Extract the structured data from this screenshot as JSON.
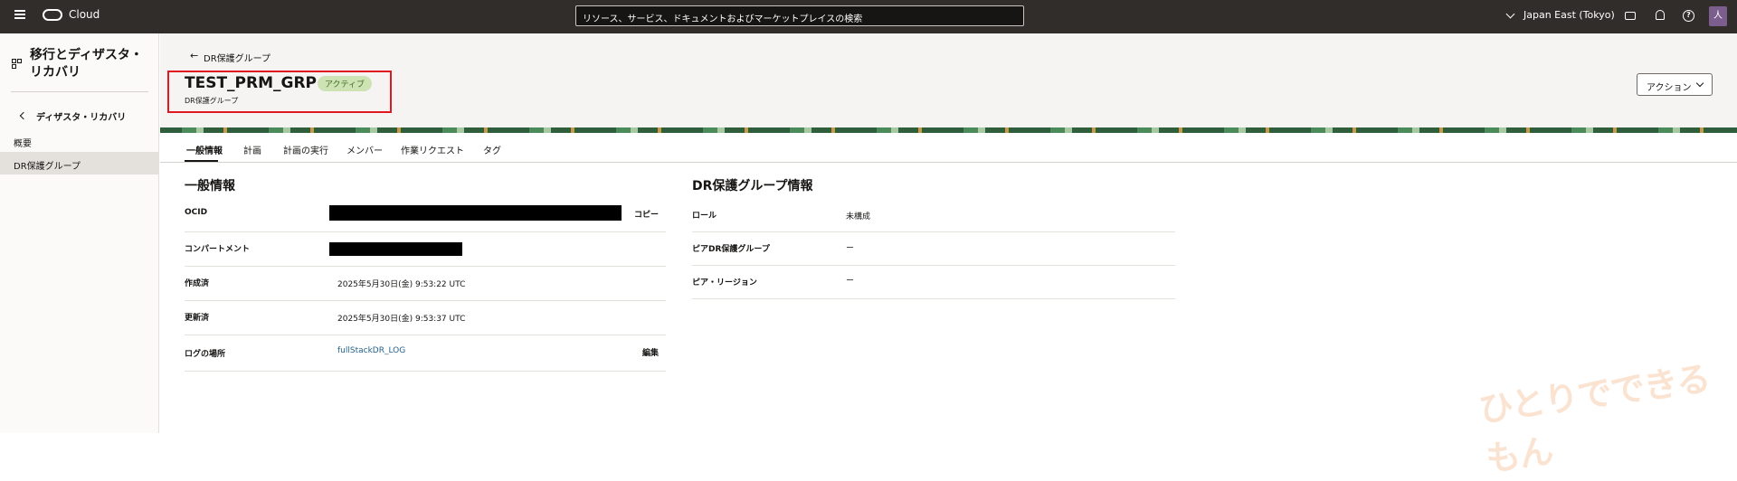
{
  "topbar": {
    "brand": "Cloud",
    "search_placeholder": "リソース、サービス、ドキュメントおよびマーケットプレイスの検索",
    "region": "Japan East (Tokyo)",
    "avatar_letter": "人"
  },
  "sidebar": {
    "title": "移行とディザスタ・リカバリ",
    "back_label": "ディザスタ・リカバリ",
    "items": [
      {
        "label": "概要"
      },
      {
        "label": "DR保護グループ"
      }
    ]
  },
  "header": {
    "back_link": "DR保護グループ",
    "title": "TEST_PRM_GRP",
    "status": "アクティブ",
    "subtitle": "DR保護グループ",
    "action_button": "アクション"
  },
  "tabs": [
    {
      "label": "一般情報"
    },
    {
      "label": "計画"
    },
    {
      "label": "計画の実行"
    },
    {
      "label": "メンバー"
    },
    {
      "label": "作業リクエスト"
    },
    {
      "label": "タグ"
    }
  ],
  "general": {
    "title": "一般情報",
    "rows": [
      {
        "label": "OCID",
        "value": "",
        "action": "コピー"
      },
      {
        "label": "コンパートメント",
        "value": ""
      },
      {
        "label": "作成済",
        "value": "2025年5月30日(金) 9:53:22 UTC"
      },
      {
        "label": "更新済",
        "value": "2025年5月30日(金) 9:53:37 UTC"
      },
      {
        "label": "ログの場所",
        "value": "fullStackDR_LOG",
        "action": "編集"
      }
    ]
  },
  "dr_info": {
    "title": "DR保護グループ情報",
    "rows": [
      {
        "label": "ロール",
        "value": "未構成"
      },
      {
        "label": "ピアDR保護グループ",
        "value": "ー"
      },
      {
        "label": "ピア・リージョン",
        "value": "ー"
      }
    ]
  },
  "watermark": "ひとりでできるもん"
}
